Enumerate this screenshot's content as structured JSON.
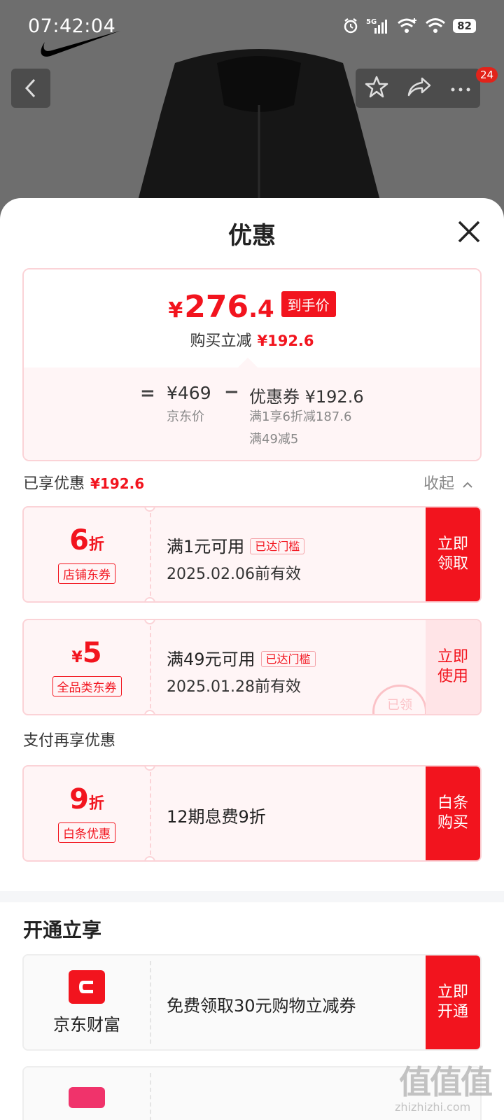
{
  "status_bar": {
    "time": "07:42:04",
    "network": "5G",
    "battery": "82"
  },
  "nav": {
    "cart_badge": "24"
  },
  "sheet": {
    "title": "优惠"
  },
  "price_summary": {
    "currency": "¥",
    "final_price_int": "276",
    "final_price_dec": ".4",
    "final_tag": "到手价",
    "instant_discount_label": "购买立减",
    "instant_discount_value": "¥192.6",
    "equals": "=",
    "jd_price": "¥469",
    "jd_price_label": "京东价",
    "minus": "−",
    "coupon_line": "优惠券 ¥192.6",
    "coupon_detail_1": "满1享6折减187.6",
    "coupon_detail_2": "满49减5"
  },
  "enjoyed": {
    "label": "已享优惠",
    "value": "¥192.6",
    "collapse": "收起"
  },
  "coupons": [
    {
      "value": "6",
      "unit": "折",
      "type": "店铺东券",
      "condition": "满1元可用",
      "reach_tag": "已达门槛",
      "expire": "2025.02.06前有效",
      "action_line1": "立即",
      "action_line2": "领取"
    },
    {
      "prefix": "¥",
      "value": "5",
      "type": "全品类东券",
      "condition": "满49元可用",
      "reach_tag": "已达门槛",
      "expire": "2025.01.28前有效",
      "action_line1": "立即",
      "action_line2": "使用",
      "stamp": "已领"
    }
  ],
  "pay_section": {
    "label": "支付再享优惠",
    "value": "9",
    "unit": "折",
    "type": "白条优惠",
    "desc": "12期息费9折",
    "action_line1": "白条",
    "action_line2": "购买"
  },
  "open_section": {
    "title": "开通立享",
    "brand": "京东财富",
    "desc": "免费领取30元购物立减券",
    "action_line1": "立即",
    "action_line2": "开通"
  },
  "watermark": {
    "big": "值值值",
    "small": "zhizhizhi.com"
  },
  "colors": {
    "accent": "#f2141e",
    "card_bg": "#fff5f6",
    "card_border": "#fbd3d7"
  }
}
